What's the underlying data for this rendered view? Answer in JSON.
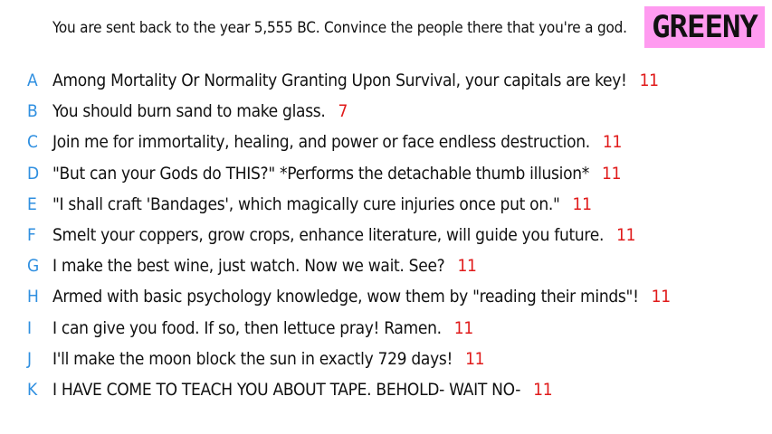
{
  "prompt": "You are sent back to the year 5,555 BC. Convince the people there that you're a god.",
  "badge": "GREENY",
  "colors": {
    "letter": "#2f8fe0",
    "score": "#e01a1a",
    "badge_bg": "#ff9bf0"
  },
  "answers": [
    {
      "letter": "A",
      "text": "Among Mortality Or Normality Granting Upon Survival, your capitals are key!",
      "score": "11"
    },
    {
      "letter": "B",
      "text": "You should burn sand to make glass.",
      "score": "7"
    },
    {
      "letter": "C",
      "text": "Join me for immortality, healing, and power or face endless destruction.",
      "score": "11"
    },
    {
      "letter": "D",
      "text": "\"But can your Gods do THIS?\" *Performs the detachable thumb illusion*",
      "score": "11"
    },
    {
      "letter": "E",
      "text": "\"I shall craft 'Bandages', which magically cure injuries once put on.\"",
      "score": "11"
    },
    {
      "letter": "F",
      "text": "Smelt your coppers, grow crops, enhance literature, will guide you future.",
      "score": "11"
    },
    {
      "letter": "G",
      "text": "I make the best wine, just watch. Now we wait. See?",
      "score": "11"
    },
    {
      "letter": "H",
      "text": "Armed with basic psychology knowledge, wow them by \"reading their minds\"!",
      "score": "11"
    },
    {
      "letter": "I",
      "text": "I can give you food. If so, then lettuce pray! Ramen.",
      "score": "11"
    },
    {
      "letter": "J",
      "text": "I'll make the moon block the sun in exactly 729 days!",
      "score": "11"
    },
    {
      "letter": "K",
      "text": "I HAVE COME TO TEACH YOU ABOUT TAPE. BEHOLD- WAIT NO-",
      "score": "11"
    }
  ]
}
